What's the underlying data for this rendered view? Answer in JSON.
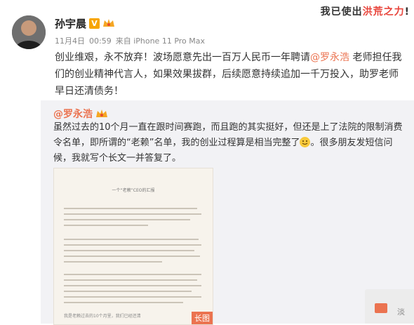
{
  "banner": {
    "text_prefix": "我已使出",
    "text_highlight": "洪荒之力",
    "text_suffix": "!"
  },
  "post": {
    "author": "孙宇晨",
    "verified_badge": "V",
    "date": "11月4日",
    "time": "00:59",
    "source": "来自 iPhone 11 Pro Max",
    "text_part1": "创业维艰，永不放弃！波场愿意先出一百万人民币一年聘请",
    "mention": "@罗永浩",
    "text_part2": " 老师担任我们的创业精神代言人，如果效果拔群，后续愿意持续追加一千万投入，助罗老师早日还清债务！"
  },
  "repost": {
    "author": "@罗永浩",
    "text_part1": "虽然过去的10个月一直在跟时间赛跑，而且跑的其实挺好，但还是上了法院的限制消费令名单，即所谓的“老赖”名单，我的创业过程算是相当完整了",
    "text_part2": "。很多朋友发短信问候，我就写个长文一并答复了。",
    "long_image_badge": "长图",
    "doc_title": "一个“老赖”CEO的汇报",
    "doc_footer": "我是老赖过去的10个月里，我们已经还清"
  },
  "side_action": {
    "label": "淡"
  },
  "colors": {
    "accent": "#eb7350",
    "banner_highlight": "#e8453c",
    "repost_bg": "#f2f2f5",
    "verified": "#f7a500"
  },
  "icons": [
    "verified-icon",
    "vip-crown-icon",
    "smile-emoji-icon",
    "share-icon"
  ]
}
